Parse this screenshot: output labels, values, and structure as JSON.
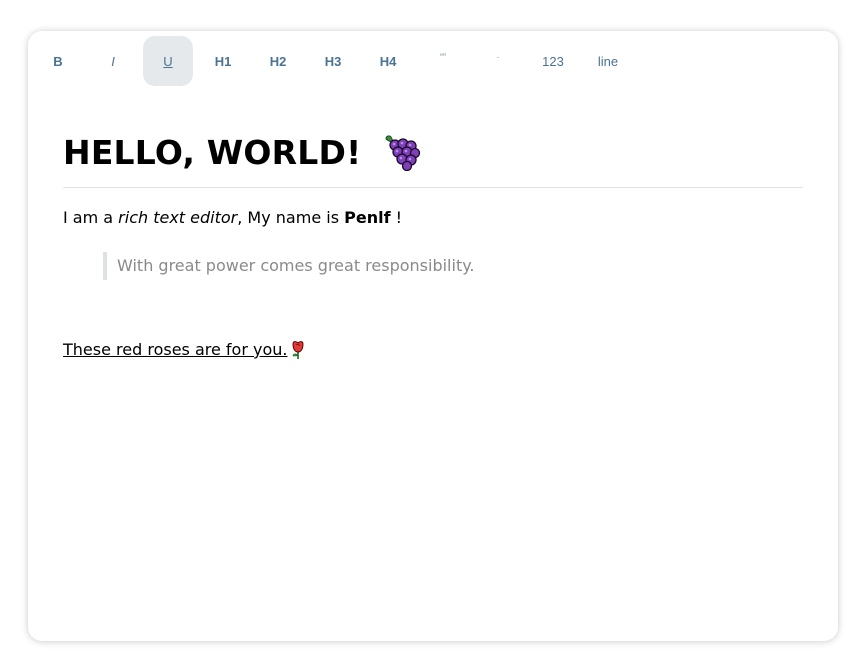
{
  "toolbar": {
    "buttons": [
      {
        "label": "B",
        "active": false
      },
      {
        "label": "I",
        "active": false
      },
      {
        "label": "U",
        "active": true
      },
      {
        "label": "H1",
        "active": false
      },
      {
        "label": "H2",
        "active": false
      },
      {
        "label": "H3",
        "active": false
      },
      {
        "label": "H4",
        "active": false
      },
      {
        "label": "“”",
        "active": false
      },
      {
        "label": "·",
        "active": false
      },
      {
        "label": "123",
        "active": false
      },
      {
        "label": "line",
        "active": false
      }
    ]
  },
  "editor": {
    "heading": "HELLO, WORLD!",
    "heading_icon": "grapes-icon",
    "paragraph": {
      "prefix": "I am a ",
      "italic": "rich text editor",
      "middle": ", My name is ",
      "bold": "Penlf",
      "suffix": " !"
    },
    "blockquote": "With great power comes great responsibility.",
    "underlined_line": "These red roses are for you.",
    "underlined_icon": "rose-icon"
  },
  "colors": {
    "toolbar_text": "#4b7394",
    "active_button_bg": "#e6e9eb",
    "quote_text": "#8a8a8a",
    "divider": "#dfe2e5"
  }
}
